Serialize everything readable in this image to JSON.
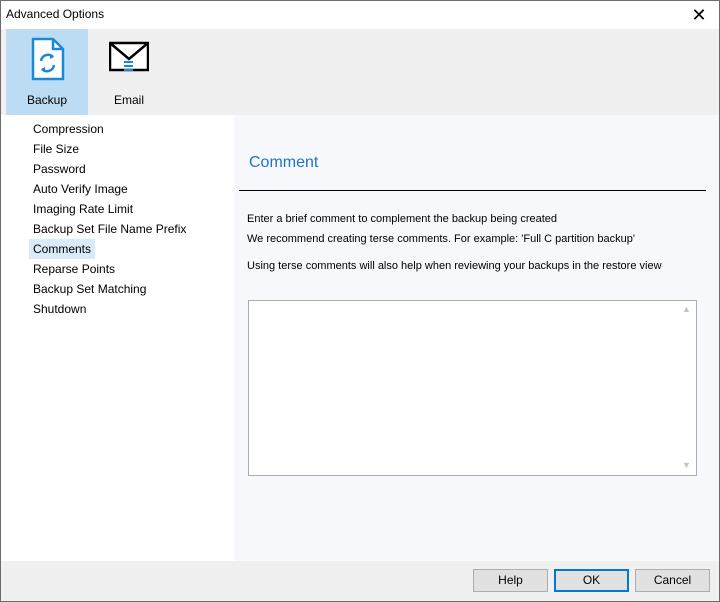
{
  "window": {
    "title": "Advanced Options",
    "close_glyph": "✕"
  },
  "toolbar": {
    "items": [
      {
        "label": "Backup",
        "icon": "backup-document-icon",
        "selected": true,
        "accent": "#1a8ad4"
      },
      {
        "label": "Email",
        "icon": "envelope-icon",
        "selected": false
      }
    ]
  },
  "sidebar": {
    "items": [
      {
        "label": "Compression"
      },
      {
        "label": "File Size"
      },
      {
        "label": "Password"
      },
      {
        "label": "Auto Verify Image"
      },
      {
        "label": "Imaging Rate Limit"
      },
      {
        "label": "Backup Set File Name Prefix"
      },
      {
        "label": "Comments",
        "selected": true
      },
      {
        "label": "Reparse Points"
      },
      {
        "label": "Backup Set Matching"
      },
      {
        "label": "Shutdown"
      }
    ]
  },
  "panel": {
    "heading": "Comment",
    "heading_color": "#1e74c4",
    "line1": "Enter a brief comment to complement the backup being created",
    "line2": "We recommend creating terse comments. For example: 'Full C partition backup'",
    "line3": "Using terse comments will also help when reviewing your backups in the restore view",
    "comment_value": ""
  },
  "footer": {
    "help": "Help",
    "ok": "OK",
    "cancel": "Cancel"
  }
}
